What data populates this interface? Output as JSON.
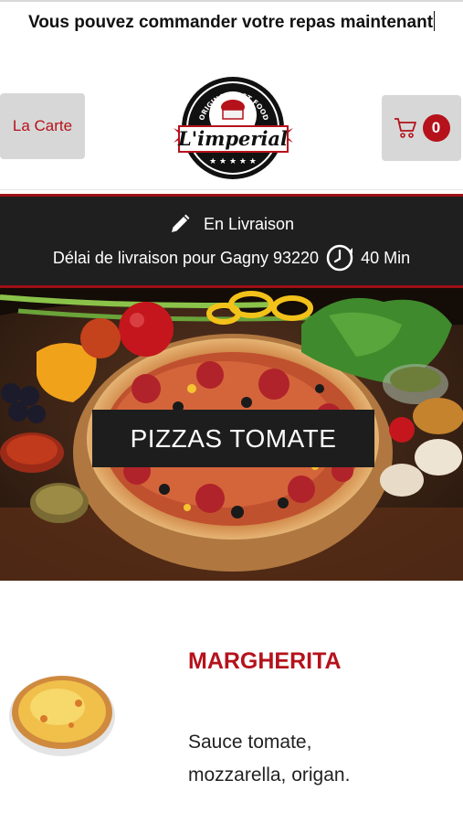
{
  "header": {
    "announcement": "Vous pouvez commander votre repas maintenant"
  },
  "nav": {
    "menu_label": "La Carte",
    "cart_count": "0"
  },
  "logo": {
    "arc_text": "ORIGINAL FAST FOOD",
    "brand": "L'imperial"
  },
  "delivery": {
    "mode": "En Livraison",
    "delay_label": "Délai de livraison pour Gagny 93220",
    "delay_value": "40 Min"
  },
  "hero": {
    "category_title": "PIZZAS TOMATE"
  },
  "product": {
    "name": "MARGHERITA",
    "description": "Sauce tomate, mozzarella, origan."
  },
  "colors": {
    "accent_red": "#b5121b",
    "dark_band": "#1f1f1f",
    "button_grey": "#d7d7d7"
  },
  "icons": [
    "pencil-icon",
    "clock-icon",
    "cart-icon"
  ]
}
